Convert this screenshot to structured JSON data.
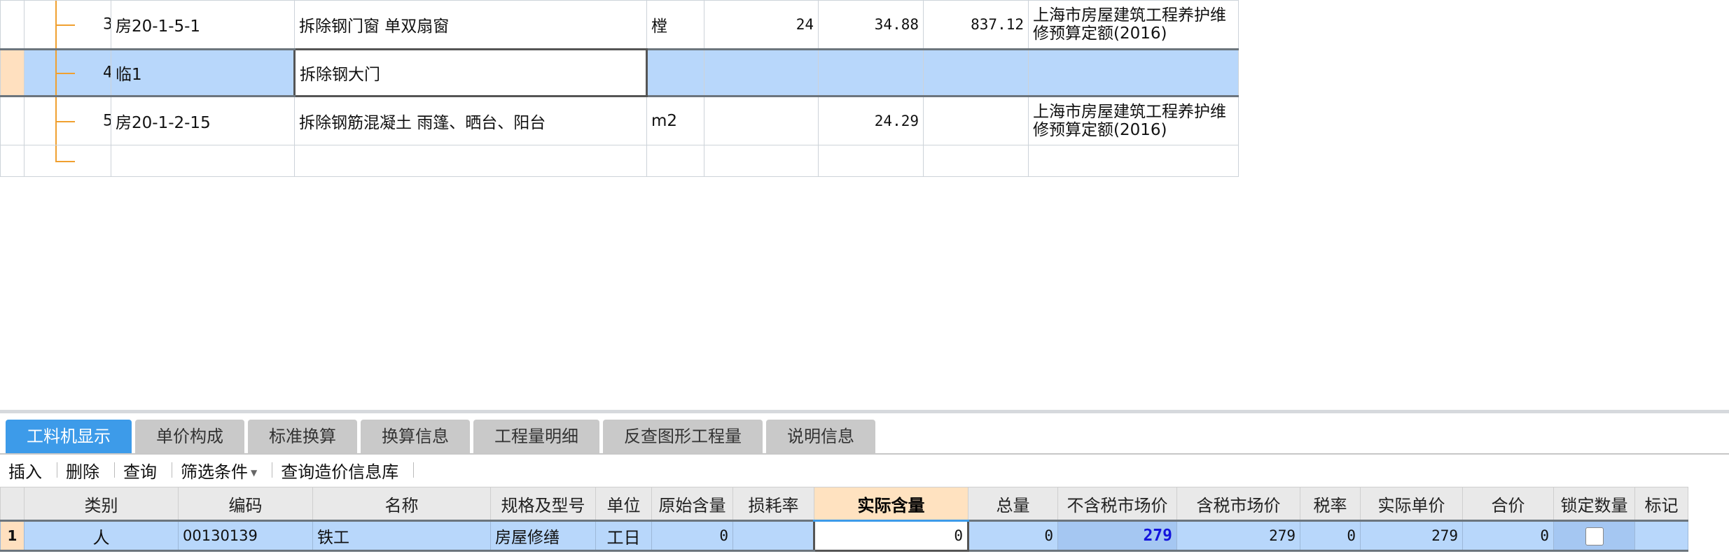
{
  "upper_grid": {
    "rows": [
      {
        "no": "3",
        "code": "房20-1-5-1",
        "name": "拆除钢门窗 单双扇窗",
        "unit": "樘",
        "qty": "24",
        "price": "34.88",
        "total": "837.12",
        "source": "上海市房屋建筑工程养护维修预算定额(2016)"
      },
      {
        "no": "4",
        "code": "临1",
        "name": "拆除钢大门",
        "unit": "",
        "qty": "",
        "price": "",
        "total": "",
        "source": ""
      },
      {
        "no": "5",
        "code": "房20-1-2-15",
        "name": "拆除钢筋混凝土 雨篷、晒台、阳台",
        "unit": "m2",
        "qty": "",
        "price": "24.29",
        "total": "",
        "source": "上海市房屋建筑工程养护维修预算定额(2016)"
      }
    ]
  },
  "tabs": [
    "工料机显示",
    "单价构成",
    "标准换算",
    "换算信息",
    "工程量明细",
    "反查图形工程量",
    "说明信息"
  ],
  "toolbar": {
    "insert": "插入",
    "delete": "删除",
    "query": "查询",
    "filter": "筛选条件",
    "price_db": "查询造价信息库"
  },
  "lower_grid": {
    "headers": [
      "类别",
      "编码",
      "名称",
      "规格及型号",
      "单位",
      "原始含量",
      "损耗率",
      "实际含量",
      "总量",
      "不含税市场价",
      "含税市场价",
      "税率",
      "实际单价",
      "合价",
      "锁定数量",
      "标记"
    ],
    "row": {
      "index": "1",
      "category": "人",
      "code": "00130139",
      "name": "铁工",
      "spec": "房屋修缮",
      "unit": "工日",
      "orig_qty": "0",
      "loss_rate": "",
      "actual_qty": "0",
      "total_qty": "0",
      "mkt_price_ex_tax": "279",
      "mkt_price_inc_tax": "279",
      "tax_rate": "0",
      "actual_unit_price": "279",
      "amount": "0",
      "locked": false,
      "mark": ""
    }
  },
  "colors": {
    "selection": "#b8d7fb",
    "active_tab": "#3d9be9",
    "highlight_header": "#ffe2c0",
    "tree_line": "#f0a030",
    "price_text": "#1414dd"
  }
}
